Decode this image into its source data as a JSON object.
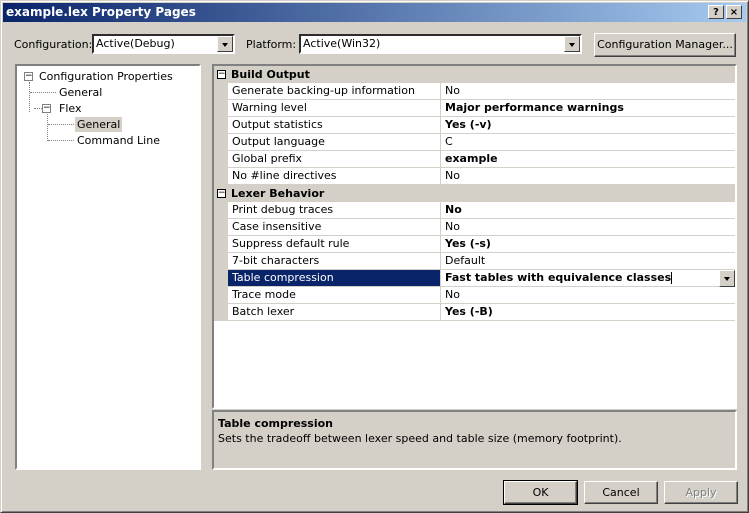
{
  "window": {
    "title": "example.lex Property Pages",
    "help_label": "?",
    "close_label": "×"
  },
  "configuration": {
    "label": "Configuration:",
    "value": "Active(Debug)"
  },
  "platform": {
    "label": "Platform:",
    "value": "Active(Win32)"
  },
  "config_manager_label": "Configuration Manager...",
  "tree": {
    "root": "Configuration Properties",
    "general": "General",
    "flex": "Flex",
    "flex_general": "General",
    "command_line": "Command Line"
  },
  "grid": {
    "categories": [
      {
        "name": "Build Output",
        "rows": [
          {
            "name": "Generate backing-up information",
            "value": "No",
            "bold": false
          },
          {
            "name": "Warning level",
            "value": "Major performance warnings",
            "bold": true
          },
          {
            "name": "Output statistics",
            "value": "Yes (-v)",
            "bold": true
          },
          {
            "name": "Output language",
            "value": "C",
            "bold": false
          },
          {
            "name": "Global prefix",
            "value": "example",
            "bold": true
          },
          {
            "name": "No #line directives",
            "value": "No",
            "bold": false
          }
        ]
      },
      {
        "name": "Lexer Behavior",
        "rows": [
          {
            "name": "Print debug traces",
            "value": "No",
            "bold": true
          },
          {
            "name": "Case insensitive",
            "value": "No",
            "bold": false
          },
          {
            "name": "Suppress default rule",
            "value": "Yes (-s)",
            "bold": true
          },
          {
            "name": "7-bit characters",
            "value": "Default",
            "bold": false
          },
          {
            "name": "Table compression",
            "value": "Fast tables with equivalence classes",
            "bold": true,
            "selected": true
          },
          {
            "name": "Trace mode",
            "value": "No",
            "bold": false
          },
          {
            "name": "Batch lexer",
            "value": "Yes (-B)",
            "bold": true
          }
        ]
      }
    ]
  },
  "description": {
    "title": "Table compression",
    "text": "Sets the tradeoff between lexer speed and table size (memory footprint)."
  },
  "buttons": {
    "ok": "OK",
    "cancel": "Cancel",
    "apply": "Apply"
  },
  "colors": {
    "selection": "#0a246a",
    "face": "#d4d0c8",
    "title_start": "#0a246a",
    "title_end": "#a6caf0"
  }
}
